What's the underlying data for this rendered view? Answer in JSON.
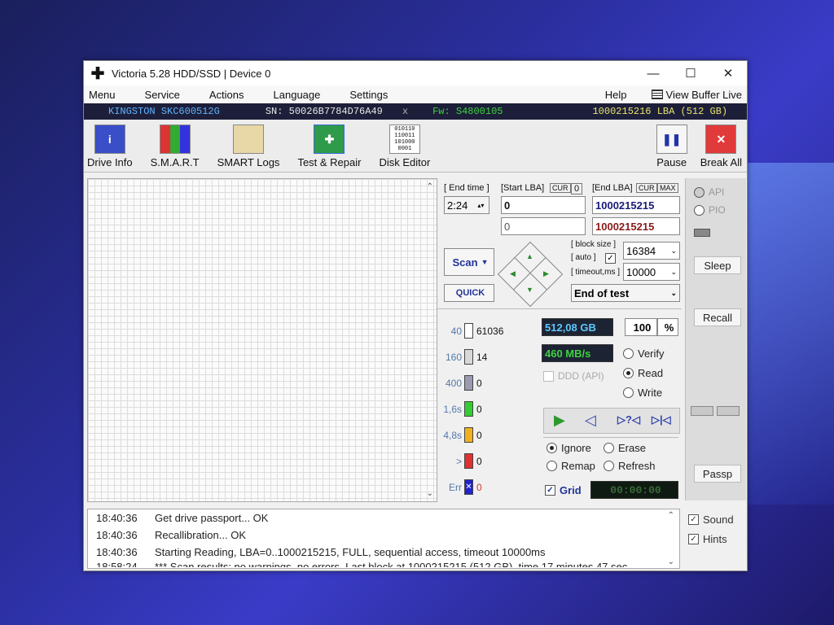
{
  "window": {
    "title": "Victoria 5.28 HDD/SSD | Device 0",
    "controls": {
      "minimize": "—",
      "maximize": "☐",
      "close": "✕"
    }
  },
  "menu": {
    "items": [
      "Menu",
      "Service",
      "Actions",
      "Language",
      "Settings"
    ],
    "help": "Help",
    "view_buffer": "View Buffer Live"
  },
  "drive": {
    "model": "KINGSTON SKC600512G",
    "serial": "SN: 50026B7784D76A49",
    "x": "x",
    "firmware": "Fw: S4800105",
    "lba": "1000215216 LBA (512 GB)",
    "colors": {
      "model": "#5fb3ff",
      "serial": "#e6e6e6",
      "firmware": "#3fd23f",
      "lba": "#e8e36a"
    }
  },
  "toolbar": {
    "drive_info": "Drive Info",
    "smart": "S.M.A.R.T",
    "smart_logs": "SMART Logs",
    "test_repair": "Test & Repair",
    "disk_editor": "Disk Editor",
    "pause": "Pause",
    "break_all": "Break All",
    "disk_editor_icon_text": "010110 110011 101000 0001"
  },
  "scan": {
    "end_time_label": "[ End time ]",
    "end_time_value": "2:24",
    "start_lba_label": "[Start LBA]",
    "cur_label": "CUR",
    "cur_value": "0",
    "end_lba_label": "[End LBA]",
    "end_cur_label": "CUR",
    "max_label": "MAX",
    "start_lba": "0",
    "end_lba": "1000215215",
    "start_lba_2": "0",
    "end_lba_2": "1000215215",
    "scan_button": "Scan",
    "quick_button": "QUICK",
    "block_size_label": "[ block size ]",
    "auto_label": "[ auto ]",
    "block_size": "16384",
    "timeout_label": "[ timeout,ms ]",
    "timeout": "10000",
    "end_action": "End of test"
  },
  "legend": [
    {
      "label": "40",
      "count": "61036",
      "color": "#ffffff"
    },
    {
      "label": "160",
      "count": "14",
      "color": "#d8d8d8"
    },
    {
      "label": "400",
      "count": "0",
      "color": "#9a9ab0"
    },
    {
      "label": "1,6s",
      "count": "0",
      "color": "#33cc33"
    },
    {
      "label": "4,8s",
      "count": "0",
      "color": "#f0b020"
    },
    {
      "label": ">",
      "count": "0",
      "color": "#e03030"
    },
    {
      "label": "Err",
      "count": "0",
      "color": "#2222cc"
    }
  ],
  "stats": {
    "size": "512,08 GB",
    "percent": "100",
    "percent_unit": "%",
    "speed": "460 MB/s",
    "ddd": "DDD (API)"
  },
  "modes": {
    "verify": "Verify",
    "read": "Read",
    "write": "Write",
    "selected": "read"
  },
  "actions": {
    "ignore": "Ignore",
    "erase": "Erase",
    "remap": "Remap",
    "refresh": "Refresh",
    "selected": "ignore"
  },
  "grid": {
    "label": "Grid",
    "timer": "00:00:00"
  },
  "side": {
    "api": "API",
    "pio": "PIO",
    "sleep": "Sleep",
    "recall": "Recall",
    "passp": "Passp"
  },
  "bottom_checks": {
    "sound": "Sound",
    "hints": "Hints"
  },
  "log": [
    {
      "time": "18:40:36",
      "msg": "Get drive passport... OK"
    },
    {
      "time": "18:40:36",
      "msg": "Recallibration... OK"
    },
    {
      "time": "18:40:36",
      "msg": "Starting Reading, LBA=0..1000215215, FULL, sequential access, timeout 10000ms"
    },
    {
      "time": "18:58:24",
      "msg": "*** Scan results: no warnings, no errors. Last block at 1000215215 (512 GB), time 17 minutes 47 sec"
    }
  ]
}
